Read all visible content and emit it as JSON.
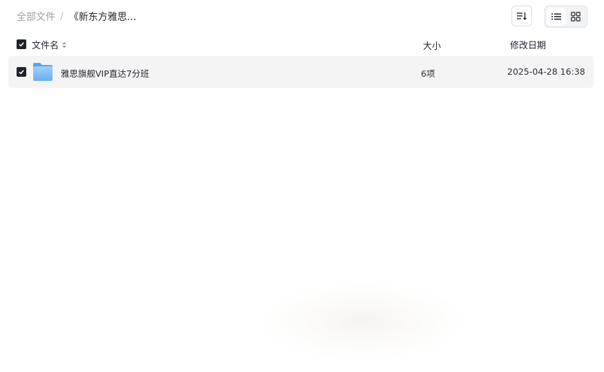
{
  "breadcrumb": {
    "root": "全部文件",
    "separator": "/",
    "current": "《新东方雅思..."
  },
  "toolbar": {
    "sort_icon": "sort-icon",
    "view_list_icon": "list-view-icon",
    "view_grid_icon": "grid-view-icon",
    "active_view": "list"
  },
  "table": {
    "headers": {
      "name": "文件名",
      "size": "大小",
      "modified": "修改日期"
    },
    "select_all_checked": true,
    "rows": [
      {
        "checked": true,
        "icon": "folder-icon",
        "name": "雅思旗舰VIP直达7分班",
        "size": "6项",
        "modified": "2025-04-28 16:38"
      }
    ]
  },
  "colors": {
    "text": "#1f2329",
    "muted": "#9aa0a6",
    "row_bg": "#f4f4f5",
    "folder": "#7fbdf3"
  }
}
